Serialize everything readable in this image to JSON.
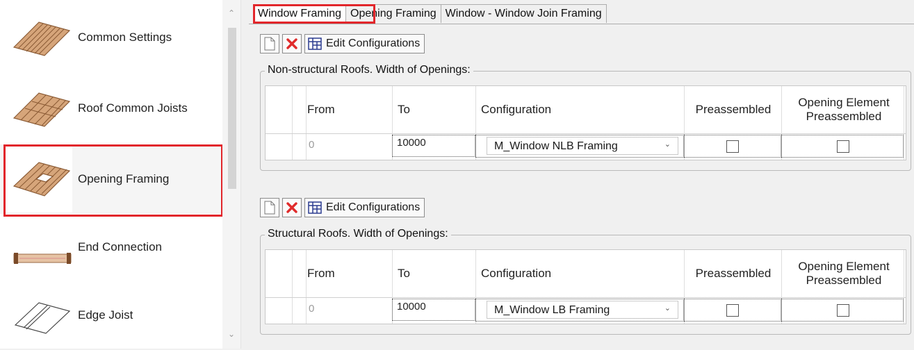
{
  "sidebar": {
    "items": [
      {
        "label": "Common Settings",
        "icon": "joists-icon"
      },
      {
        "label": "Roof Common Joists",
        "icon": "roof-joists-icon"
      },
      {
        "label": "Opening Framing",
        "icon": "opening-framing-icon",
        "selected": true
      },
      {
        "label": "End Connection",
        "icon": "end-connection-icon"
      },
      {
        "label": "Edge Joist",
        "icon": "edge-joist-icon"
      }
    ]
  },
  "tabs": [
    {
      "label": "Window Framing",
      "active": true
    },
    {
      "label": "Opening Framing"
    },
    {
      "label": "Window - Window Join Framing"
    }
  ],
  "toolbar": {
    "edit_label": "Edit Configurations"
  },
  "groups": [
    {
      "title": "Non-structural Roofs. Width of Openings:",
      "headers": {
        "from": "From",
        "to": "To",
        "configuration": "Configuration",
        "preassembled": "Preassembled",
        "opening_element_preassembled": "Opening Element Preassembled"
      },
      "row": {
        "from": "0",
        "to": "10000",
        "configuration": "M_Window NLB Framing",
        "preassembled": false,
        "opening_element_preassembled": false
      }
    },
    {
      "title": "Structural Roofs. Width of Openings:",
      "headers": {
        "from": "From",
        "to": "To",
        "configuration": "Configuration",
        "preassembled": "Preassembled",
        "opening_element_preassembled": "Opening Element Preassembled"
      },
      "row": {
        "from": "0",
        "to": "10000",
        "configuration": "M_Window LB Framing",
        "preassembled": false,
        "opening_element_preassembled": false
      }
    }
  ],
  "colors": {
    "highlight": "#e2262b",
    "delete": "#e02b2b",
    "wood": "#b5825a"
  }
}
